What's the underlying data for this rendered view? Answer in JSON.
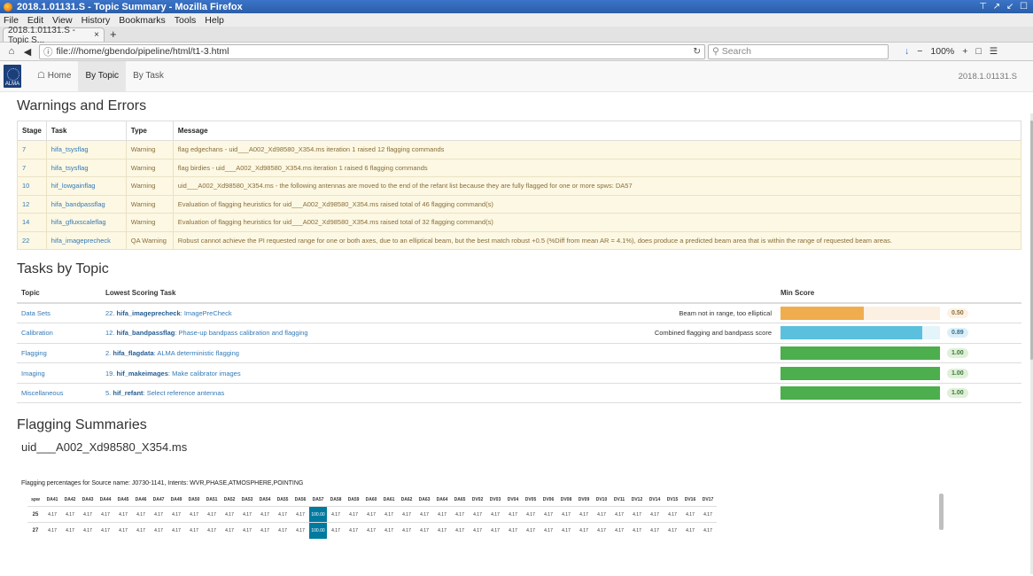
{
  "window": {
    "title": "2018.1.01131.S - Topic Summary - Mozilla Firefox",
    "controls": "⊤ ↗ ↙ ☐"
  },
  "menu": [
    "File",
    "Edit",
    "View",
    "History",
    "Bookmarks",
    "Tools",
    "Help"
  ],
  "tab": {
    "label": "2018.1.01131.S - Topic S...",
    "close": "×",
    "new": "+"
  },
  "nav": {
    "url": "file:///home/gbendo/pipeline/html/t1-3.html",
    "search_placeholder": "Search",
    "zoom": "100%",
    "zoom_minus": "−",
    "zoom_plus": "+"
  },
  "app": {
    "logo_text": "ALMA",
    "nav": [
      "Home",
      "By Topic",
      "By Task"
    ],
    "version": "2018.1.01131.S"
  },
  "warnings": {
    "heading": "Warnings and Errors",
    "columns": [
      "Stage",
      "Task",
      "Type",
      "Message"
    ],
    "rows": [
      {
        "stage": "7",
        "task": "hifa_tsysflag",
        "type": "Warning",
        "message": "flag edgechans - uid___A002_Xd98580_X354.ms iteration 1 raised 12 flagging commands"
      },
      {
        "stage": "7",
        "task": "hifa_tsysflag",
        "type": "Warning",
        "message": "flag birdies - uid___A002_Xd98580_X354.ms iteration 1 raised 6 flagging commands"
      },
      {
        "stage": "10",
        "task": "hif_lowgainflag",
        "type": "Warning",
        "message": "uid___A002_Xd98580_X354.ms - the following antennas are moved to the end of the refant list because they are fully flagged for one or more spws: DA57"
      },
      {
        "stage": "12",
        "task": "hifa_bandpassflag",
        "type": "Warning",
        "message": "Evaluation of flagging heuristics for uid___A002_Xd98580_X354.ms raised total of 46 flagging command(s)"
      },
      {
        "stage": "14",
        "task": "hifa_gfluxscaleflag",
        "type": "Warning",
        "message": "Evaluation of flagging heuristics for uid___A002_Xd98580_X354.ms raised total of 32 flagging command(s)"
      },
      {
        "stage": "22",
        "task": "hifa_imageprecheck",
        "type": "QA Warning",
        "message": "Robust cannot achieve the PI requested range for one or both axes, due to an elliptical beam, but the best match robust +0.5 (%Diff from mean AR = 4.1%), does produce a predicted beam area that is within the range of requested beam areas."
      }
    ]
  },
  "topics": {
    "heading": "Tasks by Topic",
    "columns": [
      "Topic",
      "Lowest Scoring Task",
      "Min Score"
    ],
    "rows": [
      {
        "topic": "Data Sets",
        "task_num": "22.",
        "task_name": "hifa_imageprecheck",
        "task_desc": ": ImagePreCheck",
        "note": "Beam not in range, too elliptical",
        "score": "0.50",
        "fill": 0.52,
        "color": "#f0ad4e",
        "track": "#fcf0e3",
        "badge_bg": "#fcf1e2",
        "badge_fg": "#8a6d3b"
      },
      {
        "topic": "Calibration",
        "task_num": "12.",
        "task_name": "hifa_bandpassflag",
        "task_desc": ": Phase-up bandpass calibration and flagging",
        "note": "Combined flagging and bandpass score",
        "score": "0.89",
        "fill": 0.89,
        "color": "#5bc0de",
        "track": "#e3f4fa",
        "badge_bg": "#dceff8",
        "badge_fg": "#31708f"
      },
      {
        "topic": "Flagging",
        "task_num": "2.",
        "task_name": "hifa_flagdata",
        "task_desc": ": ALMA deterministic flagging",
        "note": "",
        "score": "1.00",
        "fill": 1.0,
        "color": "#4cae4c",
        "track": "#e6f3e6",
        "badge_bg": "#dff0d8",
        "badge_fg": "#3c763d"
      },
      {
        "topic": "Imaging",
        "task_num": "19.",
        "task_name": "hif_makeimages",
        "task_desc": ": Make calibrator images",
        "note": "",
        "score": "1.00",
        "fill": 1.0,
        "color": "#4cae4c",
        "track": "#e6f3e6",
        "badge_bg": "#dff0d8",
        "badge_fg": "#3c763d"
      },
      {
        "topic": "Miscellaneous",
        "task_num": "5.",
        "task_name": "hif_refant",
        "task_desc": ": Select reference antennas",
        "note": "",
        "score": "1.00",
        "fill": 1.0,
        "color": "#4cae4c",
        "track": "#e6f3e6",
        "badge_bg": "#dff0d8",
        "badge_fg": "#3c763d"
      }
    ]
  },
  "flagging": {
    "heading": "Flagging Summaries",
    "ms_name": "uid___A002_Xd98580_X354.ms",
    "note": "Flagging percentages for Source name: J0730-1141, Intents: WVR,PHASE,ATMOSPHERE,POINTING",
    "spw_label": "spw",
    "antennas": [
      "DA41",
      "DA42",
      "DA43",
      "DA44",
      "DA45",
      "DA46",
      "DA47",
      "DA49",
      "DA50",
      "DA51",
      "DA52",
      "DA53",
      "DA54",
      "DA55",
      "DA56",
      "DA57",
      "DA58",
      "DA59",
      "DA60",
      "DA61",
      "DA62",
      "DA63",
      "DA64",
      "DA65",
      "DV02",
      "DV03",
      "DV04",
      "DV05",
      "DV06",
      "DV08",
      "DV09",
      "DV10",
      "DV11",
      "DV12",
      "DV14",
      "DV15",
      "DV16",
      "DV17"
    ],
    "rows": [
      {
        "spw": "25",
        "value": "4.17",
        "hot": "100.00",
        "hot_col": "DA57"
      },
      {
        "spw": "27",
        "value": "4.17",
        "hot": "100.00",
        "hot_col": "DA57"
      }
    ]
  }
}
